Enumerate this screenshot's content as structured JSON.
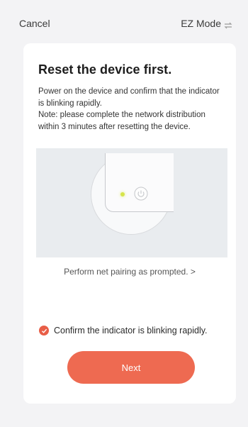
{
  "header": {
    "cancel_label": "Cancel",
    "mode_label": "EZ Mode",
    "mode_icon": "switch-arrows-icon"
  },
  "card": {
    "title": "Reset the device first.",
    "desc_line1": "Power on the device and confirm that the indicator is blinking rapidly.",
    "desc_line2": "Note: please complete the network distribution within 3 minutes after resetting the device.",
    "pairing_link": "Perform net pairing as prompted. >",
    "confirm_label": "Confirm the indicator is blinking rapidly.",
    "confirm_checked": true,
    "next_label": "Next"
  },
  "colors": {
    "accent": "#ee6a51",
    "checkbox": "#e85e47",
    "led": "#d6e44b",
    "background": "#f3f3f5"
  }
}
